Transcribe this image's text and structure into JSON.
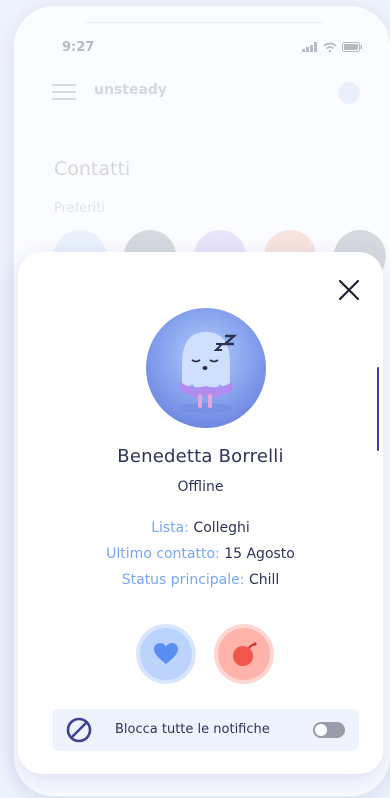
{
  "status_bar": {
    "time": "9:27"
  },
  "app": {
    "title": "unsteady"
  },
  "contacts": {
    "title": "Contatti",
    "favorites_label": "Preferiti"
  },
  "profile": {
    "name": "Benedetta Borrelli",
    "status": "Offline",
    "fields": [
      {
        "label": "Lista:",
        "value": "Colleghi"
      },
      {
        "label": "Ultimo contatto:",
        "value": "15 Agosto"
      },
      {
        "label": "Status principale:",
        "value": "Chill"
      }
    ],
    "avatar_icon": "sleeping-ghost-icon"
  },
  "actions": {
    "heart_icon": "heart-icon",
    "bomb_icon": "bomb-icon"
  },
  "notifications": {
    "label": "Blocca tutte le notifiche",
    "enabled": false
  },
  "colors": {
    "accent_blue": "#7aa6f5",
    "text_dark": "#2f3358",
    "heart_bg": "#bcd3fb",
    "bomb_bg": "#ffb3ab",
    "toggle_off": "#9a9da9"
  }
}
